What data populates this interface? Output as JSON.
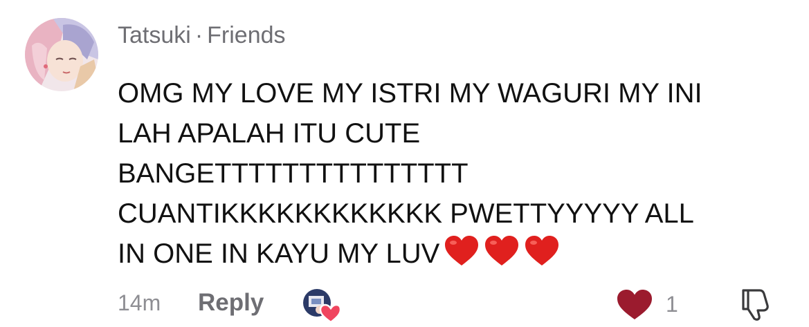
{
  "comment": {
    "author": "Tatsuki",
    "separator": "·",
    "relationship": "Friends",
    "text_lines": [
      "OMG MY LOVE MY ISTRI MY WAGURI MY INI",
      "LAH APALAH ITU CUTE",
      "BANGETTTTTTTTTTTTTTT",
      "CUANTIKKKKKKKKKKKK PWETTYYYYY ALL",
      "IN ONE IN KAYU MY LUV"
    ],
    "emojis": [
      "red-heart-emoji",
      "red-heart-emoji",
      "red-heart-emoji"
    ]
  },
  "footer": {
    "timestamp": "14m",
    "reply_label": "Reply",
    "like_count": "1",
    "liked": true
  },
  "icons": {
    "like": "heart-icon",
    "dislike": "thumbs-down-icon",
    "liked_by": "creator-liked-avatar"
  },
  "colors": {
    "liked_heart": "#9b1b2e",
    "emoji_heart": "#e0201e",
    "meta_text": "#6e6e73",
    "muted": "#8e8e93"
  }
}
